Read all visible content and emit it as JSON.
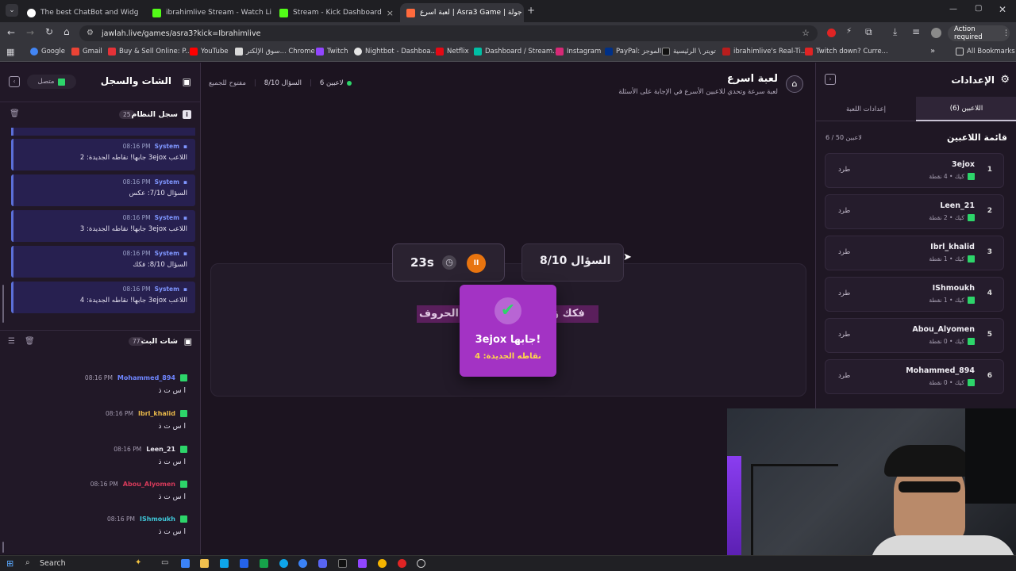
{
  "tabs": [
    {
      "label": "The best ChatBot and Widg",
      "color": "#ffffff"
    },
    {
      "label": "ibrahimlive Stream - Watch Live",
      "color": "#53fc18"
    },
    {
      "label": "Stream - Kick Dashboard",
      "color": "#53fc18"
    },
    {
      "label": "لعبة اسرع | Asra3 Game | جولة",
      "color": "#ff6a3d"
    }
  ],
  "url": "jawlah.live/games/asra3?kick=Ibrahimlive",
  "action_required": "Action required",
  "bookmarks": [
    "Google",
    "Gmail",
    "Buy & Sell Online: P...",
    "YouTube",
    "سوق الإلكتر... Chrome",
    "Twitch",
    "Nightbot - Dashboa...",
    "Netflix",
    "Dashboard / Stream...",
    "Instagram",
    "PayPal: الموجز",
    "تويتر \\ الرئيسية",
    "ibrahimlive's Real-Ti...",
    "Twitch down? Curre..."
  ],
  "all_bookmarks": "All Bookmarks",
  "chat_panel": {
    "title": "الشات والسجل",
    "status": "متصل",
    "system_log_title": "سجل النظام",
    "system_log_count": "25",
    "system_messages": [
      {
        "who": "System",
        "time": "08:16 PM",
        "text": "اللاعب 3ejox جابها! نقاطه الجديدة: 2"
      },
      {
        "who": "System",
        "time": "08:16 PM",
        "text": "السؤال 7/10: عكس"
      },
      {
        "who": "System",
        "time": "08:16 PM",
        "text": "اللاعب 3ejox جابها! نقاطه الجديدة: 3"
      },
      {
        "who": "System",
        "time": "08:16 PM",
        "text": "السؤال 8/10: فكك"
      },
      {
        "who": "System",
        "time": "08:16 PM",
        "text": "اللاعب 3ejox جابها! نقاطه الجديدة: 4"
      }
    ],
    "chat_title": "شات البث",
    "chat_count": "77",
    "chat_messages": [
      {
        "user": "Mohammed_894",
        "color": "#6f86ff",
        "time": "08:16 PM",
        "text": "ا س ت ذ"
      },
      {
        "user": "Ibrl_khalid",
        "color": "#e8b84a",
        "time": "08:16 PM",
        "text": "ا س ت ذ"
      },
      {
        "user": "Leen_21",
        "color": "#e9e6ef",
        "time": "08:16 PM",
        "text": "ا س ت ذ"
      },
      {
        "user": "Abou_Alyomen",
        "color": "#d63a5a",
        "time": "08:16 PM",
        "text": "ا س ت ذ"
      },
      {
        "user": "IShmoukh",
        "color": "#3fc7d9",
        "time": "08:16 PM",
        "text": "ا س ت ذ"
      }
    ]
  },
  "game": {
    "title": "لعبة اسرع",
    "subtitle": "لعبة سرعة وتحدي للاعبين الأسرع في الإجابة على الأسئلة",
    "players_chip": "6 لاعبين",
    "question_chip": "السؤال 8/10",
    "open_chip": "مفتوح للجميع",
    "timer": "23s",
    "question_label": "السؤال 8/10",
    "prompt_right": "فكك وَ",
    "prompt_left": "الحروف:",
    "winner_line": "3ejox جابها!",
    "winner_points": "نقاطه الجديدة: 4"
  },
  "settings": {
    "title": "الإعدادات",
    "tab_players": "اللاعبين (6)",
    "tab_game": "إعدادات اللعبة",
    "list_title": "قائمة اللاعبين",
    "capacity": "6 / 50 لاعبين",
    "kick_label": "طرد",
    "players": [
      {
        "num": "1",
        "name": "3ejox",
        "sub": "كيك • 4 نقطة"
      },
      {
        "num": "2",
        "name": "Leen_21",
        "sub": "كيك • 2 نقطة"
      },
      {
        "num": "3",
        "name": "Ibrl_khalid",
        "sub": "كيك • 1 نقطة"
      },
      {
        "num": "4",
        "name": "IShmoukh",
        "sub": "كيك • 1 نقطة"
      },
      {
        "num": "5",
        "name": "Abou_Alyomen",
        "sub": "كيك • 0 نقطة"
      },
      {
        "num": "6",
        "name": "Mohammed_894",
        "sub": "كيك • 0 نقطة"
      }
    ]
  },
  "taskbar": {
    "search": "Search"
  }
}
